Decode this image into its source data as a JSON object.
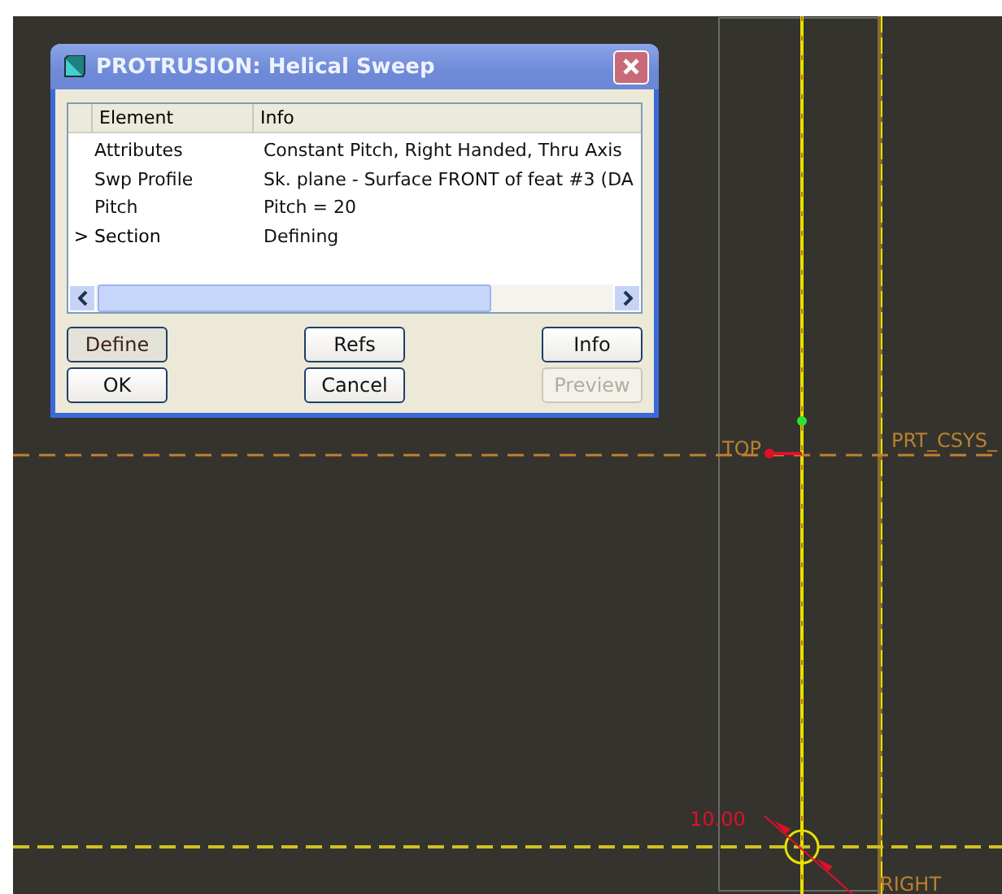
{
  "dialog": {
    "title": "PROTRUSION: Helical Sweep",
    "columns": [
      "Element",
      "Info"
    ],
    "rows": [
      {
        "element": "Attributes",
        "info": "Constant Pitch, Right Handed, Thru Axis",
        "current": false
      },
      {
        "element": "Swp Profile",
        "info": "Sk. plane - Surface FRONT of feat #3 (DA",
        "current": false
      },
      {
        "element": "Pitch",
        "info": "Pitch = 20",
        "current": false
      },
      {
        "element": "Section",
        "info": "Defining",
        "current": true,
        "marker": ">"
      }
    ],
    "buttons": [
      {
        "label": "Define",
        "pressed": true,
        "disabled": false
      },
      {
        "label": "Refs",
        "pressed": false,
        "disabled": false
      },
      {
        "label": "Info",
        "pressed": false,
        "disabled": false
      },
      {
        "label": "OK",
        "pressed": false,
        "disabled": false
      },
      {
        "label": "Cancel",
        "pressed": false,
        "disabled": false
      },
      {
        "label": "Preview",
        "pressed": false,
        "disabled": true
      }
    ]
  },
  "canvas": {
    "labels": [
      {
        "kind": "datum",
        "text": "TOP"
      },
      {
        "kind": "datum",
        "text": "PRT_CSYS_"
      },
      {
        "kind": "dimension",
        "text": "10.00"
      },
      {
        "kind": "datum",
        "text": "RIGHT"
      }
    ]
  }
}
